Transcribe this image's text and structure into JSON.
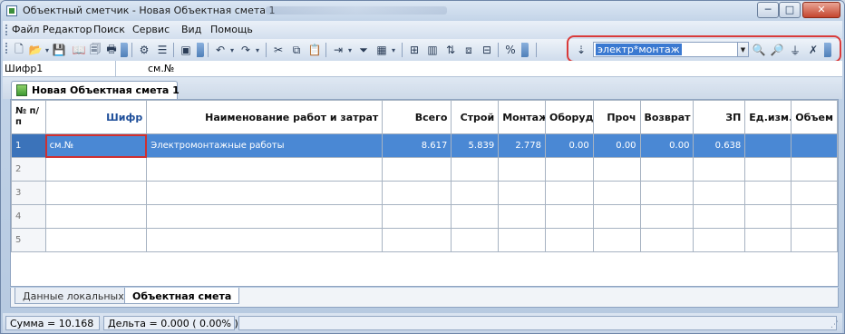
{
  "window": {
    "title": "Объектный сметчик - Новая Объектная смета 1",
    "min_glyph": "─",
    "max_glyph": "□",
    "close_glyph": "✕"
  },
  "menu": [
    "Файл",
    "Редактор",
    "Поиск",
    "Сервис",
    "Вид",
    "Помощь"
  ],
  "toolbar": {
    "filter_value": "электр*монтаж",
    "icons": [
      "new-document-icon",
      "open-folder-icon",
      "save-icon",
      "book-icon",
      "print-preview-icon",
      "print-icon",
      "properties-icon",
      "list-icon",
      "image-icon",
      "undo-icon",
      "redo-icon",
      "cut-icon",
      "copy-icon",
      "paste-icon",
      "insert-row-icon",
      "filter-funnel-icon",
      "calculator-icon",
      "table-icon",
      "chart-icon",
      "percent-icon",
      "sort-icon",
      "find-icon",
      "find-next-icon",
      "apply-filter-icon",
      "clear-filter-icon"
    ],
    "percent_label": "%"
  },
  "formula_bar": {
    "cell_ref": "Шифр1",
    "cell_value": "см.№"
  },
  "document_tab": "Новая Объектная смета 1",
  "grid": {
    "columns": [
      "№ п/п",
      "Шифр",
      "Наименование работ и затрат",
      "Всего",
      "Строй",
      "Монтаж",
      "Оборуд",
      "Проч",
      "Возврат",
      "ЗП",
      "Ед.изм.",
      "Объем"
    ],
    "rows": [
      {
        "num": "1",
        "shifr": "см.№",
        "name": "Электромонтажные работы",
        "vsego": "8.617",
        "stroy": "5.839",
        "montazh": "2.778",
        "oborud": "0.00",
        "proch": "0.00",
        "vozvrat": "0.00",
        "zp": "0.638",
        "ed": "",
        "obem": ""
      },
      {
        "num": "2",
        "shifr": "",
        "name": "",
        "vsego": "",
        "stroy": "",
        "montazh": "",
        "oborud": "",
        "proch": "",
        "vozvrat": "",
        "zp": "",
        "ed": "",
        "obem": ""
      },
      {
        "num": "3",
        "shifr": "",
        "name": "",
        "vsego": "",
        "stroy": "",
        "montazh": "",
        "oborud": "",
        "proch": "",
        "vozvrat": "",
        "zp": "",
        "ed": "",
        "obem": ""
      },
      {
        "num": "4",
        "shifr": "",
        "name": "",
        "vsego": "",
        "stroy": "",
        "montazh": "",
        "oborud": "",
        "proch": "",
        "vozvrat": "",
        "zp": "",
        "ed": "",
        "obem": ""
      },
      {
        "num": "5",
        "shifr": "",
        "name": "",
        "vsego": "",
        "stroy": "",
        "montazh": "",
        "oborud": "",
        "proch": "",
        "vozvrat": "",
        "zp": "",
        "ed": "",
        "obem": ""
      }
    ]
  },
  "sheet_tabs": [
    "Данные локальных смет",
    "Объектная смета"
  ],
  "status": {
    "sum": "Сумма = 10.168",
    "delta": "Дельта = 0.000 ( 0.00% )"
  },
  "colors": {
    "selected_row": "#4a88d4",
    "highlight_ring": "#d93a3a",
    "filter_selection": "#3a79d1"
  }
}
